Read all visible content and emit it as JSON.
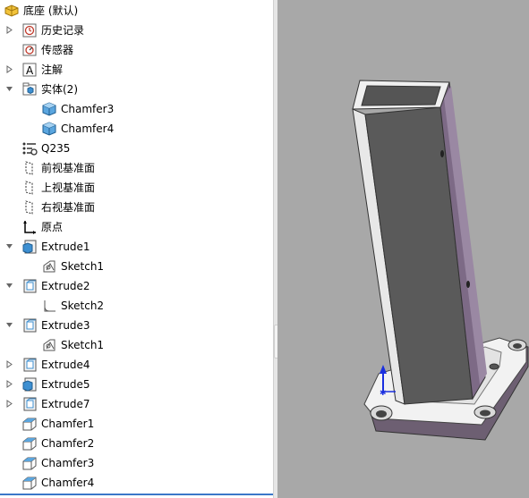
{
  "root": {
    "label": "底座 (默认)",
    "icon": "part-icon"
  },
  "tree": [
    {
      "name": "history",
      "label": "历史记录",
      "icon": "history-icon",
      "level": 1,
      "expander": "collapsed"
    },
    {
      "name": "sensors",
      "label": "传感器",
      "icon": "sensor-folder-icon",
      "level": 1,
      "expander": "none"
    },
    {
      "name": "annotations",
      "label": "注解",
      "icon": "annotation-icon",
      "level": 1,
      "expander": "collapsed"
    },
    {
      "name": "solid-bodies",
      "label": "实体(2)",
      "icon": "solid-bodies-folder-icon",
      "level": 1,
      "expander": "expanded"
    },
    {
      "name": "body-chamfer3",
      "label": "Chamfer3",
      "icon": "solid-body-icon",
      "level": 2,
      "expander": "none"
    },
    {
      "name": "body-chamfer4",
      "label": "Chamfer4",
      "icon": "solid-body-icon",
      "level": 2,
      "expander": "none"
    },
    {
      "name": "material",
      "label": "Q235",
      "icon": "material-icon",
      "level": 1,
      "expander": "none"
    },
    {
      "name": "front-plane",
      "label": "前视基准面",
      "icon": "plane-icon",
      "level": 1,
      "expander": "none"
    },
    {
      "name": "top-plane",
      "label": "上视基准面",
      "icon": "plane-icon",
      "level": 1,
      "expander": "none"
    },
    {
      "name": "right-plane",
      "label": "右视基准面",
      "icon": "plane-icon",
      "level": 1,
      "expander": "none"
    },
    {
      "name": "origin",
      "label": "原点",
      "icon": "origin-icon",
      "level": 1,
      "expander": "none"
    },
    {
      "name": "extrude1",
      "label": "Extrude1",
      "icon": "extrude-icon",
      "level": 1,
      "expander": "expanded"
    },
    {
      "name": "extrude1-sketch1",
      "label": "Sketch1",
      "icon": "sketch-icon",
      "level": 2,
      "expander": "none"
    },
    {
      "name": "extrude2",
      "label": "Extrude2",
      "icon": "extrude-cut-icon",
      "level": 1,
      "expander": "expanded"
    },
    {
      "name": "extrude2-sketch2",
      "label": "Sketch2",
      "icon": "sketch-plain-icon",
      "level": 2,
      "expander": "none"
    },
    {
      "name": "extrude3",
      "label": "Extrude3",
      "icon": "extrude-cut-icon",
      "level": 1,
      "expander": "expanded"
    },
    {
      "name": "extrude3-sketch1",
      "label": "Sketch1",
      "icon": "sketch-icon",
      "level": 2,
      "expander": "none"
    },
    {
      "name": "extrude4",
      "label": "Extrude4",
      "icon": "extrude-cut-icon",
      "level": 1,
      "expander": "collapsed"
    },
    {
      "name": "extrude5",
      "label": "Extrude5",
      "icon": "extrude-icon",
      "level": 1,
      "expander": "collapsed"
    },
    {
      "name": "extrude7",
      "label": "Extrude7",
      "icon": "extrude-cut-icon",
      "level": 1,
      "expander": "collapsed"
    },
    {
      "name": "chamfer1",
      "label": "Chamfer1",
      "icon": "chamfer-icon",
      "level": 1,
      "expander": "none"
    },
    {
      "name": "chamfer2",
      "label": "Chamfer2",
      "icon": "chamfer-icon",
      "level": 1,
      "expander": "none"
    },
    {
      "name": "chamfer3",
      "label": "Chamfer3",
      "icon": "chamfer-icon",
      "level": 1,
      "expander": "none"
    },
    {
      "name": "chamfer4",
      "label": "Chamfer4",
      "icon": "chamfer-icon",
      "level": 1,
      "expander": "none"
    }
  ],
  "colors": {
    "viewport_background": "#a8a8a8",
    "tube_inner": "#5a5a5a",
    "tube_side": "#7d6a86",
    "plate_top": "#f2f2f2",
    "plate_edge": "#6d5f72",
    "icon_blue": "#3d8fd1",
    "selection_underline": "#3b77c9"
  }
}
